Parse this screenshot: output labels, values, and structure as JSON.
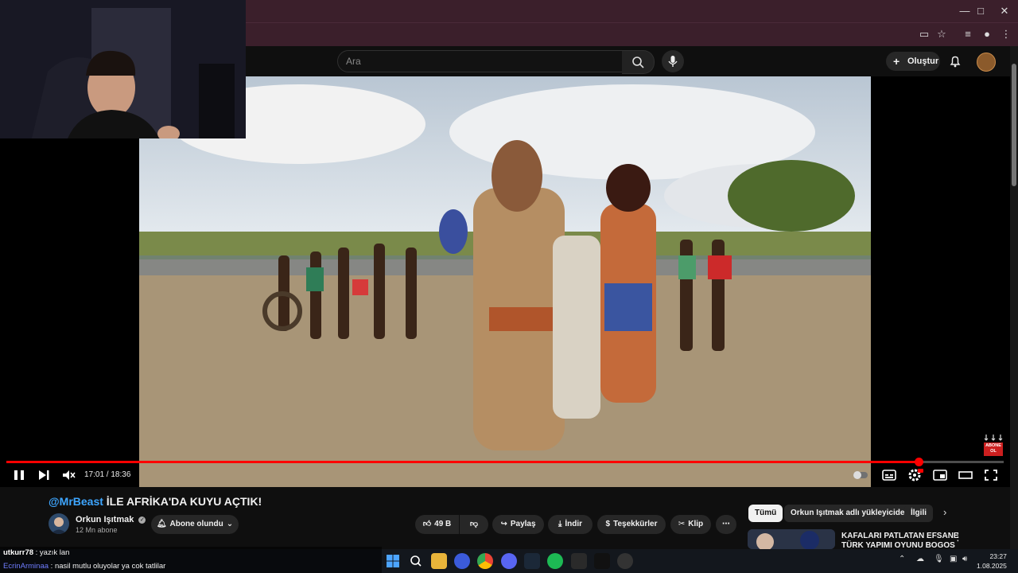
{
  "browser": {
    "window_controls": [
      "minimize",
      "maximize",
      "close"
    ],
    "toolbar_icons": [
      "cast-icon",
      "star-icon",
      "media-icon",
      "profile-icon",
      "menu-icon"
    ]
  },
  "header": {
    "search_placeholder": "Ara",
    "create_label": "Oluştur"
  },
  "player": {
    "time": "17:01 / 18:36",
    "progress_fraction": 0.915,
    "badge_lines": [
      "ABONE",
      "OL"
    ]
  },
  "video": {
    "title_mention": "@MrBeast",
    "title_rest": " İLE AFRİKA'DA KUYU AÇTIK!",
    "channel_name": "Orkun Işıtmak",
    "channel_subs": "12 Mn abone",
    "subscribed_label": "Abone olundu",
    "likes": "49 B",
    "share_label": "Paylaş",
    "download_label": "İndir",
    "thanks_label": "Teşekkürler",
    "clip_label": "Klip"
  },
  "recommendations": {
    "chips": [
      "Tümü",
      "Orkun Işıtmak adlı yükleyiciden",
      "İlgili"
    ],
    "first_title_line1": "KAFALARI PATLATAN EFSANE",
    "first_title_line2": "TÜRK YAPIMI OYUNU BOGOS"
  },
  "chat": [
    {
      "user": "utkurr78",
      "message": " : yazık lan"
    },
    {
      "user": "EcrinArminaa",
      "message": " : nasil mutlu oluyolar ya cok tatlilar"
    }
  ],
  "taskbar": {
    "time": "23:27",
    "date": "1.08.2025"
  },
  "colors": {
    "accent": "#ff0000",
    "link": "#3ea6ff",
    "browser_frame": "#3b1f2b",
    "background": "#0f0f0f"
  }
}
